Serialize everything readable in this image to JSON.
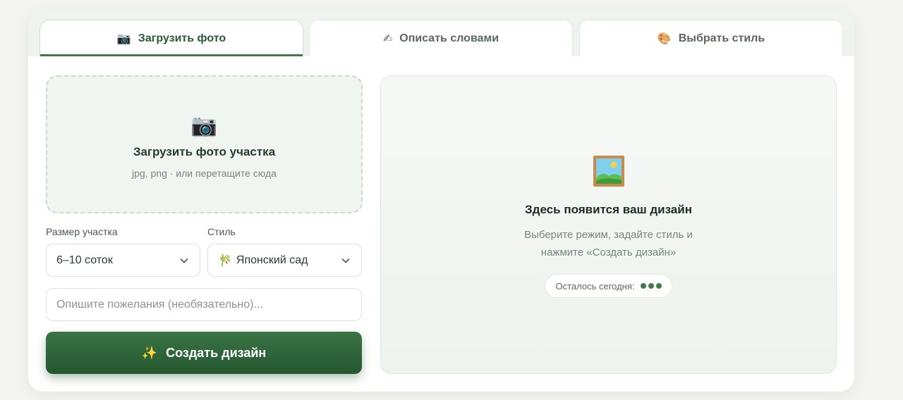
{
  "tabs": [
    {
      "icon": "camera-icon",
      "glyph": "📷",
      "label": "Загрузить фото",
      "active": true
    },
    {
      "icon": "writing-hand-icon",
      "glyph": "✍",
      "label": "Описать словами",
      "active": false
    },
    {
      "icon": "palette-icon",
      "glyph": "🎨",
      "label": "Выбрать стиль",
      "active": false
    }
  ],
  "upload": {
    "icon": "camera-icon",
    "glyph": "📷",
    "title": "Загрузить фото участка",
    "hint": "jpg, png · или перетащите сюда"
  },
  "form": {
    "size_label": "Размер участка",
    "size_value": "6–10 соток",
    "style_label": "Стиль",
    "style_icon": "bamboo-icon",
    "style_glyph": "🎋",
    "style_value": "Японский сад",
    "wish_placeholder": "Опишите пожелания (необязательно)...",
    "wish_value": ""
  },
  "create_button": {
    "icon": "sparkles-icon",
    "glyph": "✨",
    "label": "Создать дизайн"
  },
  "preview": {
    "icon": "framed-picture-icon",
    "title": "Здесь появится ваш дизайн",
    "subtitle_line1": "Выберите режим, задайте стиль и",
    "subtitle_line2": "нажмите «Создать дизайн»",
    "remaining_label": "Осталось сегодня:",
    "remaining_count": 3
  },
  "colors": {
    "accent": "#3e7a4a",
    "button_dark": "#24572f",
    "tabs_bg": "#eef3ee",
    "upload_border": "#c8dcc9"
  }
}
